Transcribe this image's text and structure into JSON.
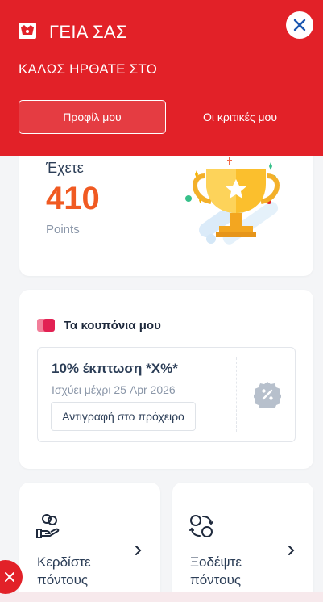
{
  "header": {
    "greeting": "ΓΕΙΑ ΣΑΣ",
    "welcome": "ΚΑΛΩΣ ΗΡΘΑΤΕ ΣΤΟ",
    "tabs": [
      {
        "label": "Προφίλ μου",
        "active": true
      },
      {
        "label": "Οι κριτικές μου",
        "active": false
      }
    ],
    "color": "#e22128"
  },
  "points": {
    "label": "Έχετε",
    "value": "410",
    "unit": "Points",
    "accent": "#f05a22"
  },
  "coupons": {
    "title": "Τα κουπόνια μου",
    "items": [
      {
        "title": "10% έκπτωση *X%*",
        "valid": "Ισχύει μέχρι 25 Apr 2026",
        "copy_label": "Αντιγραφή στο πρόχειρο",
        "icon": "percent-icon"
      }
    ]
  },
  "actions": {
    "earn": {
      "label": "Κερδίστε πόντους",
      "icon": "hand-coins-icon"
    },
    "spend": {
      "label": "Ξοδέψτε πόντους",
      "icon": "exchange-icon"
    }
  }
}
